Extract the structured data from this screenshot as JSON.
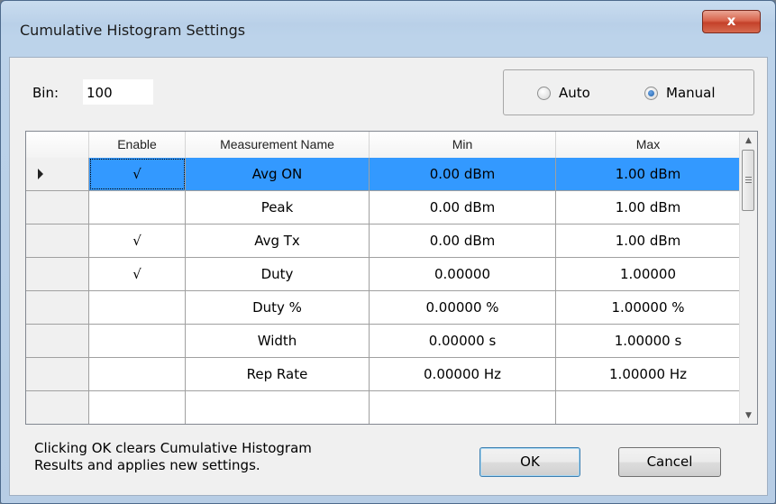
{
  "window": {
    "title": "Cumulative Histogram Settings",
    "close_label": "x"
  },
  "bin": {
    "label": "Bin:",
    "value": "100"
  },
  "mode": {
    "auto_label": "Auto",
    "manual_label": "Manual",
    "selected": "Manual"
  },
  "grid": {
    "columns": [
      "Enable",
      "Measurement Name",
      "Min",
      "Max"
    ],
    "rows": [
      {
        "enable": "√",
        "name": "Avg ON",
        "min": "0.00 dBm",
        "max": "1.00 dBm",
        "selected": true
      },
      {
        "enable": "",
        "name": "Peak",
        "min": "0.00 dBm",
        "max": "1.00 dBm"
      },
      {
        "enable": "√",
        "name": "Avg Tx",
        "min": "0.00 dBm",
        "max": "1.00 dBm"
      },
      {
        "enable": "√",
        "name": "Duty",
        "min": "0.00000",
        "max": "1.00000"
      },
      {
        "enable": "",
        "name": "Duty %",
        "min": "0.00000 %",
        "max": "1.00000 %"
      },
      {
        "enable": "",
        "name": "Width",
        "min": "0.00000 s",
        "max": "1.00000 s"
      },
      {
        "enable": "",
        "name": "Rep Rate",
        "min": "0.00000 Hz",
        "max": "1.00000 Hz"
      }
    ]
  },
  "footer": {
    "info_line1": "Clicking OK clears Cumulative Histogram",
    "info_line2": "Results and applies new settings.",
    "ok_label": "OK",
    "cancel_label": "Cancel"
  },
  "colors": {
    "selection": "#3399ff",
    "close_button": "#c4412a"
  }
}
